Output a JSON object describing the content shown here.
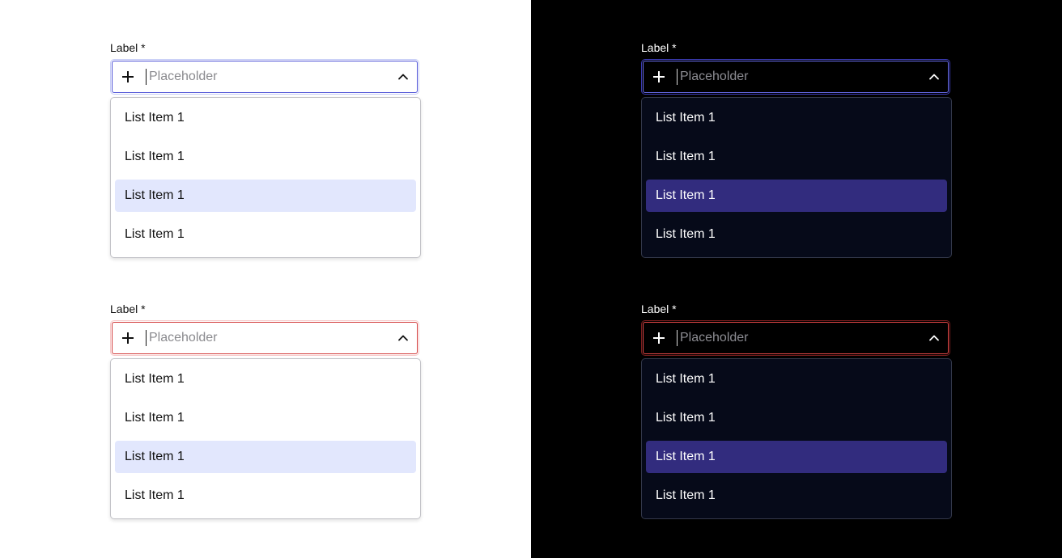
{
  "field": {
    "label": "Label *",
    "placeholder": "Placeholder",
    "options": [
      "List Item 1",
      "List Item 1",
      "List Item 1",
      "List Item 1"
    ],
    "selected_index": 2
  },
  "themes": {
    "light": {
      "background": "#ffffff",
      "focus_border": "#4b4fd6",
      "error_border": "#d23a3a",
      "selected_bg": "#e2e7fd"
    },
    "dark": {
      "background": "#000000",
      "focus_border": "#6a6ef0",
      "error_border": "#e54848",
      "selected_bg": "#322c7e"
    }
  },
  "icons": {
    "leading": "plus-icon",
    "trailing": "chevron-up-icon"
  }
}
